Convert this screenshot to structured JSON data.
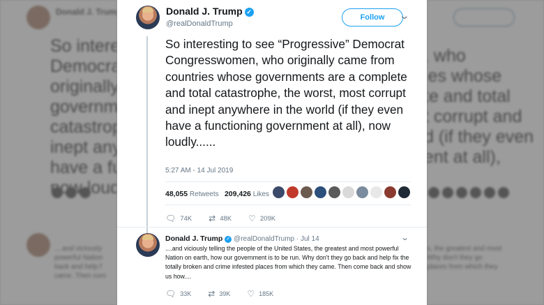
{
  "tweet": {
    "author_name": "Donald J. Trump",
    "handle": "@realDonaldTrump",
    "follow_label": "Follow",
    "text": "So interesting to see “Progressive” Democrat Congresswomen, who originally came from countries whose governments are a complete and total catastrophe, the worst, most corrupt and inept anywhere in the world (if they even have a functioning government at all), now loudly......",
    "timestamp": "5:27 AM - 14 Jul 2019",
    "retweets_count": "48,055",
    "retweets_label": "Retweets",
    "likes_count": "209,426",
    "likes_label": "Likes",
    "actions": {
      "replies": "74K",
      "retweets": "48K",
      "likes": "209K"
    }
  },
  "liker_colors": [
    "#3b4a6b",
    "#c0392b",
    "#6b5a4e",
    "#2c4f7c",
    "#5a5a5a",
    "#d9d9d9",
    "#7a8c9e",
    "#e8e8e8",
    "#8b3a2f",
    "#1f2a36"
  ],
  "reply": {
    "author_name": "Donald J. Trump",
    "handle": "@realDonaldTrump",
    "date": "Jul 14",
    "text": "....and viciously telling the people of the United States, the greatest and most powerful Nation on earth, how our government is to be run. Why don't they go back and help fix the totally broken and crime infested places from which they came. Then come back and show us how....",
    "actions": {
      "replies": "33K",
      "retweets": "39K",
      "likes": "185K"
    }
  },
  "colors": {
    "accent": "#1da1f2",
    "text": "#14171a",
    "muted": "#657786"
  }
}
